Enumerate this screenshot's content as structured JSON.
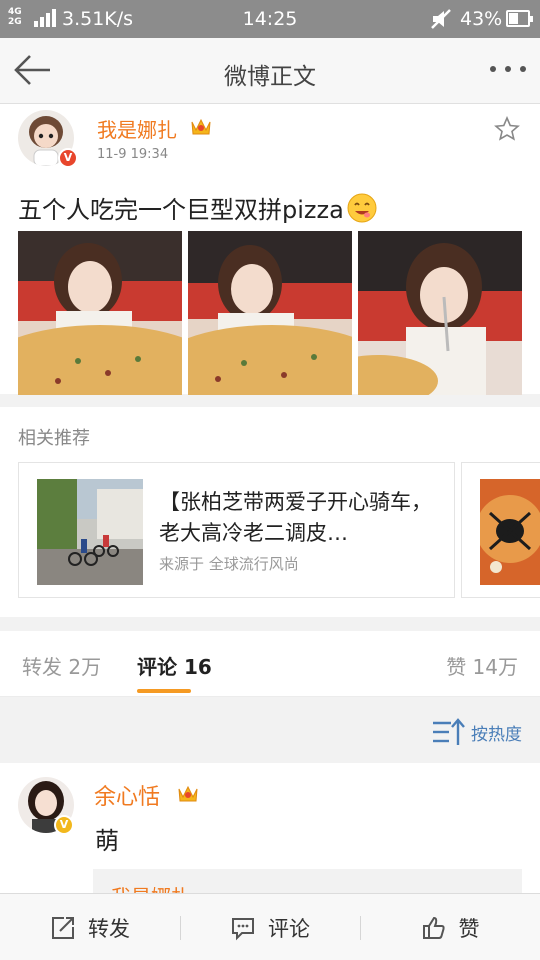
{
  "status_bar": {
    "network": "4G",
    "network2": "2G",
    "speed": "3.51K/s",
    "time": "14:25",
    "battery": "43%",
    "battery_level": 0.43
  },
  "nav": {
    "title": "微博正文",
    "back_icon": "back-arrow-icon",
    "more_icon": "more-dots-icon"
  },
  "post": {
    "username": "我是娜扎",
    "date": "11-9 19:34",
    "text": "五个人吃完一个巨型双拼pizza",
    "verified": "V",
    "emoji_icon": "smile-emoji-icon"
  },
  "related": {
    "title": "相关推荐",
    "items": [
      {
        "title": "【张柏芝带两爱子开心骑车，老大高冷老二调皮…",
        "source": "来源于 全球流行风尚"
      }
    ]
  },
  "tabs": [
    {
      "label": "转发 2万"
    },
    {
      "label": "评论 16"
    },
    {
      "label": "赞 14万"
    }
  ],
  "sort": {
    "label": "按热度"
  },
  "comment": {
    "username": "余心恬",
    "text": "萌",
    "verified": "V",
    "reply_partial": "我是娜扎"
  },
  "bottom_bar": {
    "repost": "转发",
    "comment": "评论",
    "like": "赞"
  },
  "colors": {
    "accent": "#f07a20",
    "tab_underline": "#f59a23",
    "link_blue": "#4a7eb8"
  }
}
